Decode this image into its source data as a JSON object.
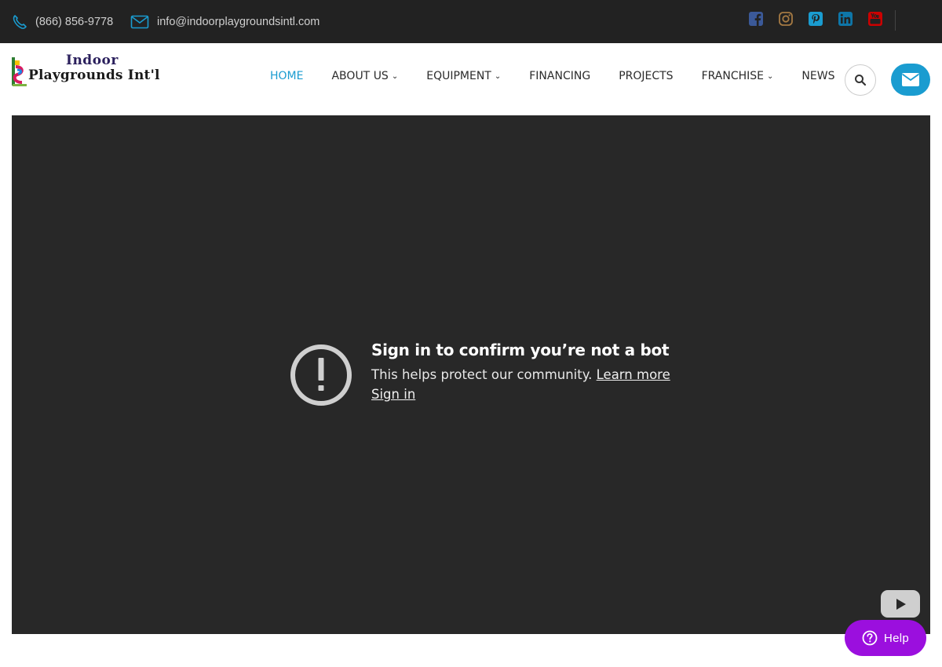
{
  "topbar": {
    "phone": "(866) 856-9778",
    "email": "info@indoorplaygroundsintl.com",
    "phone_icon": "phone-icon",
    "email_icon": "envelope-icon",
    "socials": [
      {
        "name": "facebook-icon",
        "color": "#3b5998"
      },
      {
        "name": "instagram-icon",
        "color": "#a57a43"
      },
      {
        "name": "pinterest-icon",
        "color": "#1a9cd0"
      },
      {
        "name": "linkedin-icon",
        "color": "#0e76a8"
      },
      {
        "name": "youtube-icon",
        "color": "#cc0000"
      }
    ]
  },
  "header": {
    "logo_line1": "Indoor",
    "logo_line2": "Playgrounds Int'l",
    "nav": [
      {
        "label": "HOME",
        "active": true,
        "dropdown": false
      },
      {
        "label": "ABOUT US",
        "active": false,
        "dropdown": true
      },
      {
        "label": "EQUIPMENT",
        "active": false,
        "dropdown": true
      },
      {
        "label": "FINANCING",
        "active": false,
        "dropdown": false
      },
      {
        "label": "PROJECTS",
        "active": false,
        "dropdown": false
      },
      {
        "label": "FRANCHISE",
        "active": false,
        "dropdown": true
      },
      {
        "label": "NEWS",
        "active": false,
        "dropdown": false
      }
    ],
    "search_icon": "search-icon",
    "mail_icon": "envelope-icon",
    "accent_color": "#1a9cd0"
  },
  "video": {
    "title": "Sign in to confirm you’re not a bot",
    "subtitle": "This helps protect our community.",
    "learn_more": "Learn more",
    "sign_in": "Sign in",
    "alert_icon": "exclamation-circle-icon",
    "play_icon": "youtube-play-icon",
    "background": "#282828"
  },
  "help": {
    "label": "Help",
    "icon": "question-circle-icon",
    "color": "#9b0fde"
  }
}
